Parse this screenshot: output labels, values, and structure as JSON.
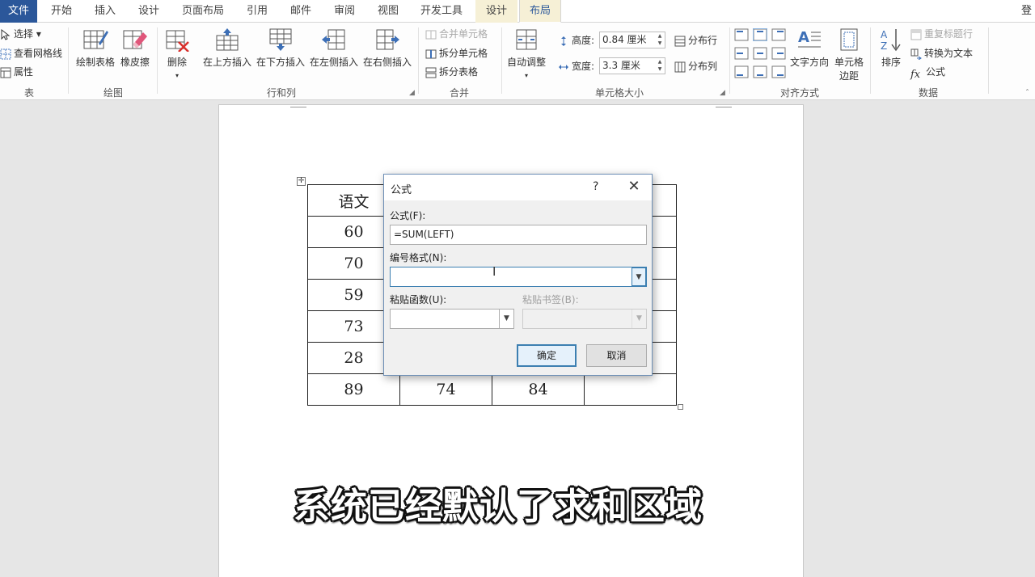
{
  "tabs": {
    "file": "文件",
    "home": "开始",
    "insert": "插入",
    "design": "设计",
    "page_layout": "页面布局",
    "references": "引用",
    "mailings": "邮件",
    "review": "审阅",
    "view": "视图",
    "developer": "开发工具",
    "table_design": "设计",
    "table_layout": "布局"
  },
  "signin": "登",
  "ribbon": {
    "table": {
      "select": "选择",
      "view_gridlines": "查看网格线",
      "properties": "属性",
      "label": "表"
    },
    "draw": {
      "draw_table": "绘制表格",
      "eraser": "橡皮擦",
      "label": "绘图"
    },
    "rows_cols": {
      "delete": "删除",
      "insert_above": "在上方插入",
      "insert_below": "在下方插入",
      "insert_left": "在左侧插入",
      "insert_right": "在右侧插入",
      "label": "行和列"
    },
    "merge": {
      "merge_cells": "合并单元格",
      "split_cells": "拆分单元格",
      "split_table": "拆分表格",
      "label": "合并"
    },
    "cell_size": {
      "autofit": "自动调整",
      "height_label": "高度:",
      "height_value": "0.84 厘米",
      "width_label": "宽度:",
      "width_value": "3.3 厘米",
      "distribute_rows": "分布行",
      "distribute_cols": "分布列",
      "label": "单元格大小"
    },
    "alignment": {
      "text_direction": "文字方向",
      "cell_margins_l1": "单元格",
      "cell_margins_l2": "边距",
      "label": "对齐方式"
    },
    "data": {
      "sort": "排序",
      "repeat_header": "重复标题行",
      "convert_to_text": "转换为文本",
      "formula": "公式",
      "label": "数据"
    }
  },
  "table": {
    "rows": [
      [
        "语文",
        "",
        "",
        ""
      ],
      [
        "60",
        "",
        "",
        ""
      ],
      [
        "70",
        "",
        "",
        ""
      ],
      [
        "59",
        "",
        "",
        ""
      ],
      [
        "73",
        "",
        "",
        ""
      ],
      [
        "28",
        "",
        "",
        ""
      ],
      [
        "89",
        "74",
        "84",
        ""
      ]
    ]
  },
  "dialog": {
    "title": "公式",
    "help": "?",
    "formula_label": "公式(F):",
    "formula_value": "=SUM(LEFT)",
    "number_format_label": "编号格式(N):",
    "number_format_value": "",
    "paste_function_label": "粘贴函数(U):",
    "paste_bookmark_label": "粘贴书签(B):",
    "ok": "确定",
    "cancel": "取消"
  },
  "caption": "系统已经默认了求和区域"
}
